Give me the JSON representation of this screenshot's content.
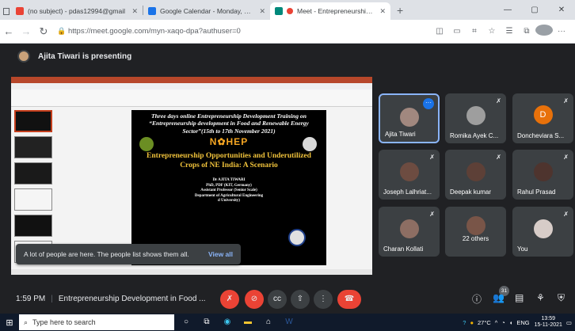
{
  "browser": {
    "tabs": [
      {
        "title": "(no subject) - pdas12994@gmail",
        "favicon_color": "#ea4335"
      },
      {
        "title": "Google Calendar - Monday, Nov",
        "favicon_color": "#1a73e8"
      },
      {
        "title": "Meet - Entrepreneurship De",
        "favicon_color": "#00897b"
      }
    ],
    "new_tab": "+",
    "url": "https://meet.google.com/myn-xaqo-dpa?authuser=0"
  },
  "presenting": {
    "text": "Ajita Tiwari is presenting"
  },
  "slide": {
    "title": "Three days online Entrepreneurship Development Training on “Entrepreneurship development in Food and Renewable Energy Sector”(15th to 17th November 2021)",
    "brand": "N✿HEP",
    "subtitle": "Entrepreneurship Opportunities and Underutilized Crops of NE India: A Scenario",
    "author_lines": [
      "Dr AJITA TIWARI",
      "PhD, PDF (KIT, Germany)",
      "Assistant Professor (Senior Scale)",
      "Department of Agricultural Engineering",
      "d University)"
    ]
  },
  "toast": {
    "message": "A lot of people are here. The people list shows them all.",
    "action": "View all"
  },
  "participants": [
    {
      "name": "Ajita Tiwari",
      "active": true
    },
    {
      "name": "Romika Ayek C..."
    },
    {
      "name": "Doncheviara S...",
      "initial": "D"
    },
    {
      "name": "Joseph Lalhriat..."
    },
    {
      "name": "Deepak kumar"
    },
    {
      "name": "Rahul Prasad"
    },
    {
      "name": "Charan Kollati"
    },
    {
      "name": "22 others"
    },
    {
      "name": "You"
    }
  ],
  "controls": {
    "time": "1:59 PM",
    "meeting_title": "Entrepreneurship Development in Food ...",
    "participant_count": "31"
  },
  "taskbar": {
    "search_placeholder": "Type here to search",
    "temperature": "27°C",
    "language": "ENG",
    "time": "13:59",
    "date": "15-11-2021"
  }
}
